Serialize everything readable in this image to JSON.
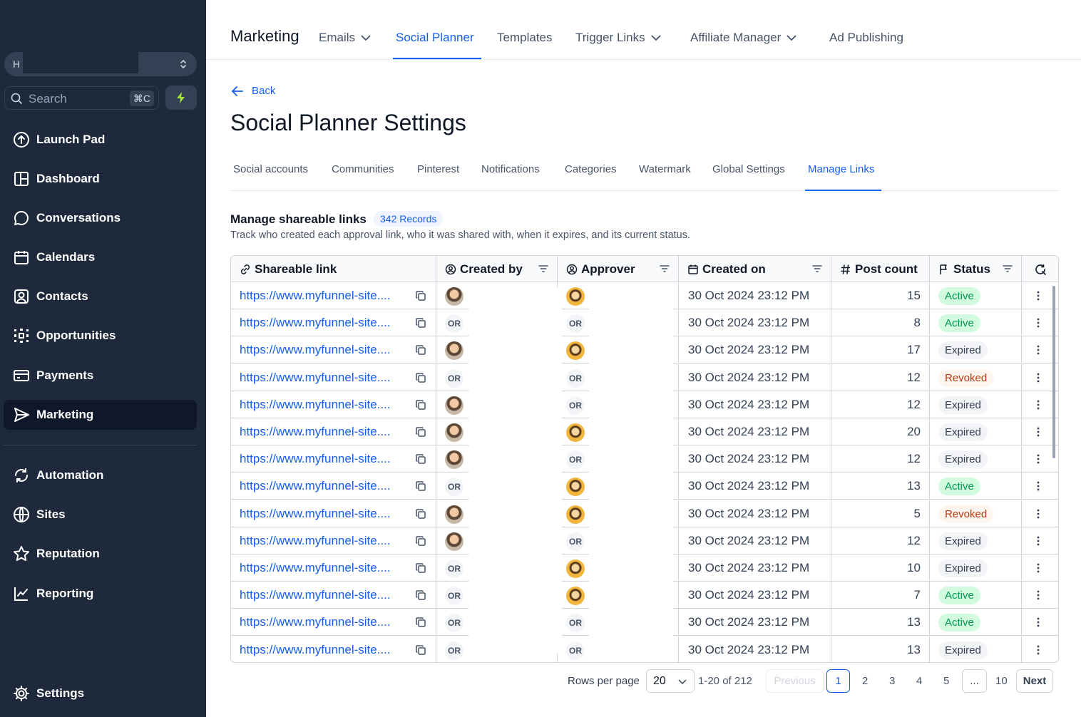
{
  "sidebar": {
    "location_initial": "H",
    "search_placeholder": "Search",
    "search_shortcut": "⌘C",
    "items": [
      {
        "label": "Launch Pad",
        "icon": "rocket-icon"
      },
      {
        "label": "Dashboard",
        "icon": "dashboard-icon"
      },
      {
        "label": "Conversations",
        "icon": "chat-icon"
      },
      {
        "label": "Calendars",
        "icon": "calendar-icon"
      },
      {
        "label": "Contacts",
        "icon": "contact-icon"
      },
      {
        "label": "Opportunities",
        "icon": "pipeline-icon"
      },
      {
        "label": "Payments",
        "icon": "credit-card-icon"
      },
      {
        "label": "Marketing",
        "icon": "send-icon",
        "active": true
      },
      {
        "label": "Automation",
        "icon": "refresh-icon"
      },
      {
        "label": "Sites",
        "icon": "globe-icon"
      },
      {
        "label": "Reputation",
        "icon": "star-icon"
      },
      {
        "label": "Reporting",
        "icon": "chart-line-icon"
      },
      {
        "label": "Settings",
        "icon": "gear-icon"
      }
    ]
  },
  "topnav": {
    "title": "Marketing",
    "tabs": [
      {
        "label": "Emails",
        "dropdown": true
      },
      {
        "label": "Social Planner",
        "active": true
      },
      {
        "label": "Templates"
      },
      {
        "label": "Trigger Links",
        "dropdown": true
      },
      {
        "label": "Affiliate Manager",
        "dropdown": true
      },
      {
        "label": "Ad Publishing"
      }
    ]
  },
  "page": {
    "back_label": "Back",
    "title": "Social Planner Settings",
    "subtabs": [
      "Social accounts",
      "Communities",
      "Pinterest",
      "Notifications",
      "Categories",
      "Watermark",
      "Global Settings",
      "Manage Links"
    ],
    "active_subtab": "Manage Links",
    "section_title": "Manage shareable links",
    "records_badge": "342 Records",
    "section_desc": "Track who created each approval link, who it was shared with, when it expires, and its current status."
  },
  "table": {
    "headers": {
      "link": "Shareable link",
      "created_by": "Created by",
      "approver": "Approver",
      "created_on": "Created on",
      "post_count": "Post count",
      "status": "Status"
    },
    "rows": [
      {
        "link": "https://www.myfunnel-site....",
        "creator_avatar": "photo-a",
        "approver_avatar": "photo-b",
        "date": "30 Oct 2024 23:12 PM",
        "count": "15",
        "status": "Active"
      },
      {
        "link": "https://www.myfunnel-site....",
        "creator_avatar": "OR",
        "approver_avatar": "OR",
        "date": "30 Oct 2024 23:12 PM",
        "count": "8",
        "status": "Active"
      },
      {
        "link": "https://www.myfunnel-site....",
        "creator_avatar": "photo-a",
        "approver_avatar": "photo-b",
        "date": "30 Oct 2024 23:12 PM",
        "count": "17",
        "status": "Expired"
      },
      {
        "link": "https://www.myfunnel-site....",
        "creator_avatar": "OR",
        "approver_avatar": "OR",
        "date": "30 Oct 2024 23:12 PM",
        "count": "12",
        "status": "Revoked"
      },
      {
        "link": "https://www.myfunnel-site....",
        "creator_avatar": "photo-a",
        "approver_avatar": "OR",
        "date": "30 Oct 2024 23:12 PM",
        "count": "12",
        "status": "Expired"
      },
      {
        "link": "https://www.myfunnel-site....",
        "creator_avatar": "photo-a",
        "approver_avatar": "photo-b",
        "date": "30 Oct 2024 23:12 PM",
        "count": "20",
        "status": "Expired"
      },
      {
        "link": "https://www.myfunnel-site....",
        "creator_avatar": "photo-a",
        "approver_avatar": "OR",
        "date": "30 Oct 2024 23:12 PM",
        "count": "12",
        "status": "Expired"
      },
      {
        "link": "https://www.myfunnel-site....",
        "creator_avatar": "OR",
        "approver_avatar": "photo-b",
        "date": "30 Oct 2024 23:12 PM",
        "count": "13",
        "status": "Active"
      },
      {
        "link": "https://www.myfunnel-site....",
        "creator_avatar": "photo-a",
        "approver_avatar": "photo-b",
        "date": "30 Oct 2024 23:12 PM",
        "count": "5",
        "status": "Revoked"
      },
      {
        "link": "https://www.myfunnel-site....",
        "creator_avatar": "photo-a",
        "approver_avatar": "OR",
        "date": "30 Oct 2024 23:12 PM",
        "count": "12",
        "status": "Expired"
      },
      {
        "link": "https://www.myfunnel-site....",
        "creator_avatar": "OR",
        "approver_avatar": "photo-b",
        "date": "30 Oct 2024 23:12 PM",
        "count": "10",
        "status": "Expired"
      },
      {
        "link": "https://www.myfunnel-site....",
        "creator_avatar": "OR",
        "approver_avatar": "photo-b",
        "date": "30 Oct 2024 23:12 PM",
        "count": "7",
        "status": "Active"
      },
      {
        "link": "https://www.myfunnel-site....",
        "creator_avatar": "OR",
        "approver_avatar": "OR",
        "date": "30 Oct 2024 23:12 PM",
        "count": "13",
        "status": "Active"
      },
      {
        "link": "https://www.myfunnel-site....",
        "creator_avatar": "OR",
        "approver_avatar": "OR",
        "date": "30 Oct 2024 23:12 PM",
        "count": "13",
        "status": "Expired"
      }
    ]
  },
  "pagination": {
    "rows_per_page_label": "Rows per page",
    "rows_per_page_value": "20",
    "range": "1-20 of 212",
    "previous": "Previous",
    "pages": [
      "1",
      "2",
      "3",
      "4",
      "5"
    ],
    "ellipsis": "...",
    "last_page": "10",
    "next": "Next",
    "current_page": "1"
  },
  "colors": {
    "sidebar_bg": "#1e293b",
    "accent": "#155eef",
    "active_status": "#039855",
    "revoked_status": "#b93815"
  }
}
